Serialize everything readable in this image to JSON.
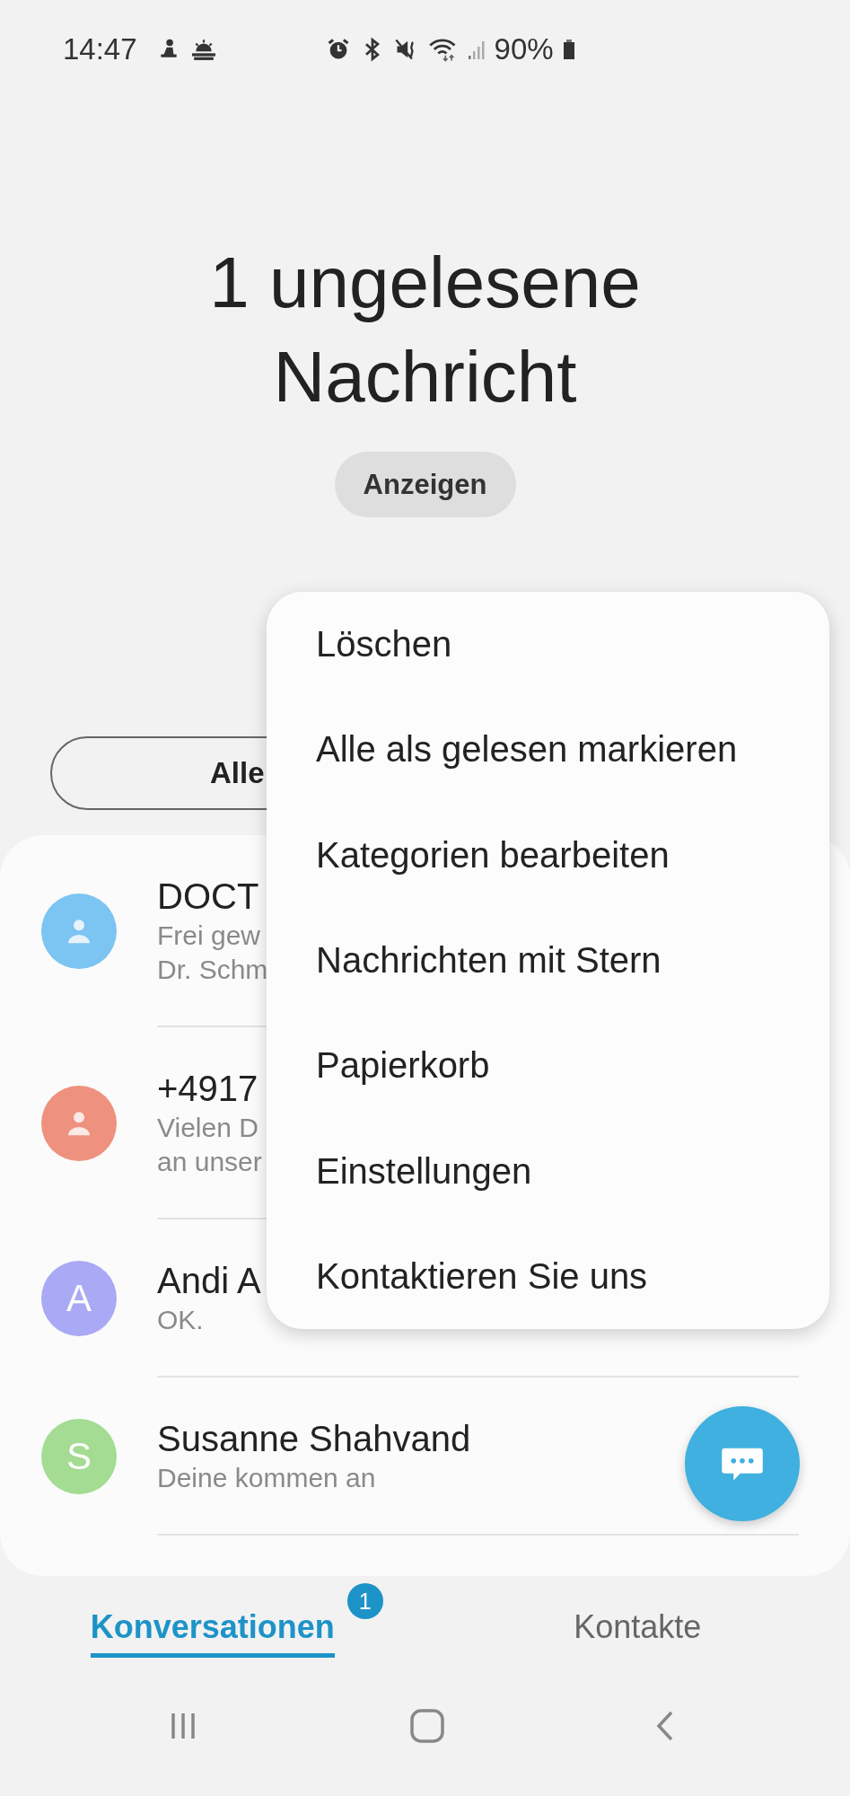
{
  "status_bar": {
    "time": "14:47",
    "battery": "90%"
  },
  "heading": "1 ungelesene Nachricht",
  "show_button": "Anzeigen",
  "filter": {
    "label": "Alle"
  },
  "conversations": [
    {
      "kind": "person",
      "name": "DOCT",
      "preview_lines": [
        "Frei gew",
        "Dr. Schm"
      ],
      "color": "#7cc4f2"
    },
    {
      "kind": "person",
      "name": "+4917",
      "preview_lines": [
        "Vielen D",
        "an unser"
      ],
      "color": "#ef917f"
    },
    {
      "kind": "letter",
      "initial": "A",
      "name": "Andi A",
      "preview_lines": [
        "OK."
      ],
      "color": "#aaa9f5"
    },
    {
      "kind": "letter",
      "initial": "S",
      "name": "Susanne Shahvand",
      "preview_lines": [
        "Deine kommen an"
      ],
      "color": "#a3dc92"
    }
  ],
  "menu": {
    "items": [
      "Löschen",
      "Alle als gelesen markieren",
      "Kategorien bearbeiten",
      "Nachrichten mit Stern",
      "Papierkorb",
      "Einstellungen",
      "Kontaktieren Sie uns"
    ]
  },
  "tabs": [
    {
      "label": "Konversationen",
      "selected": true,
      "badge": "1"
    },
    {
      "label": "Kontakte",
      "selected": false
    }
  ]
}
